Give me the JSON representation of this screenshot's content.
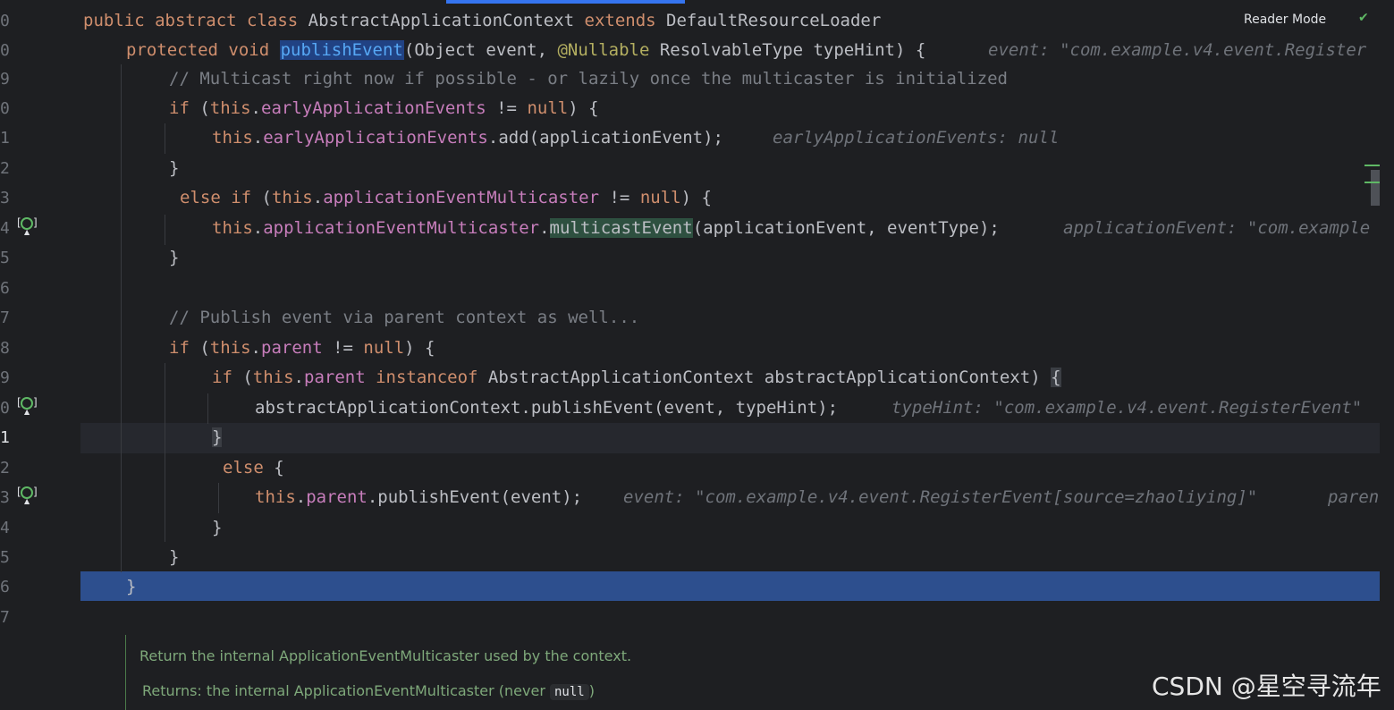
{
  "toolbar": {
    "reader_mode": "Reader Mode"
  },
  "gutter": [
    "0",
    "0",
    "9",
    "0",
    "1",
    "2",
    "3",
    "4",
    "5",
    "6",
    "7",
    "8",
    "9",
    "0",
    "1",
    "2",
    "3",
    "4",
    "5",
    "6",
    "7"
  ],
  "lines": {
    "l0": {
      "a": "public abstract class ",
      "b": "AbstractApplicationContext ",
      "c": "extends ",
      "d": "DefaultResourceLoader"
    },
    "l1": {
      "a": "protected void ",
      "b": "publishEvent",
      "c": "(Object event, ",
      "d": "@Nullable",
      "e": " ResolvableType typeHint) {",
      "hint": "event: \"com.example.v4.event.Register"
    },
    "l2": {
      "comment": "// Multicast right now if possible - or lazily once the multicaster is initialized"
    },
    "l3": {
      "a": "if ",
      "b": "(",
      "c": "this",
      "d": ".",
      "e": "earlyApplicationEvents",
      "f": " != ",
      "g": "null",
      "h": ") {"
    },
    "l4": {
      "a": "this",
      "b": ".",
      "c": "earlyApplicationEvents",
      "d": ".add(applicationEvent);",
      "hint": "earlyApplicationEvents: null"
    },
    "l5": {
      "a": "}"
    },
    "l6": {
      "a": "else if ",
      "b": "(",
      "c": "this",
      "d": ".",
      "e": "applicationEventMulticaster",
      "f": " != ",
      "g": "null",
      "h": ") {"
    },
    "l7": {
      "a": "this",
      "b": ".",
      "c": "applicationEventMulticaster",
      "d": ".",
      "e": "multicastEvent",
      "f": "(applicationEvent, eventType);",
      "hint": "applicationEvent: \"com.example"
    },
    "l8": {
      "a": "}"
    },
    "l10": {
      "comment": "// Publish event via parent context as well..."
    },
    "l11": {
      "a": "if ",
      "b": "(",
      "c": "this",
      "d": ".",
      "e": "parent",
      "f": " != ",
      "g": "null",
      "h": ") {"
    },
    "l12": {
      "a": "if ",
      "b": "(",
      "c": "this",
      "d": ".",
      "e": "parent",
      "f": " ",
      "g": "instanceof",
      "h": " AbstractApplicationContext abstractApplicationContext) ",
      "i": "{"
    },
    "l13": {
      "a": "abstractApplicationContext.publishEvent(event, typeHint);",
      "hint": "typeHint: \"com.example.v4.event.RegisterEvent\""
    },
    "l14": {
      "a": "}"
    },
    "l15": {
      "a": "else ",
      "b": "{"
    },
    "l16": {
      "a": "this",
      "b": ".",
      "c": "parent",
      "d": ".publishEvent(event);",
      "hint": "event: \"com.example.v4.event.RegisterEvent[source=zhaoliying]\"",
      "hint2": "paren"
    },
    "l17": {
      "a": "}"
    },
    "l18": {
      "a": "}"
    },
    "l19": {
      "a": "}"
    }
  },
  "doc": {
    "line1": "Return the internal ApplicationEventMulticaster used by the context.",
    "returns_label": "Returns:",
    "returns_text": " the internal ApplicationEventMulticaster (never ",
    "returns_code": "null",
    "returns_close": ")"
  },
  "watermark": "CSDN @星空寻流年",
  "colors": {
    "background": "#1e1f22",
    "keyword": "#cf8e6d",
    "function": "#56a8f5",
    "field": "#c77dbb",
    "comment": "#7a7e85",
    "selection": "#2d4f8e"
  }
}
